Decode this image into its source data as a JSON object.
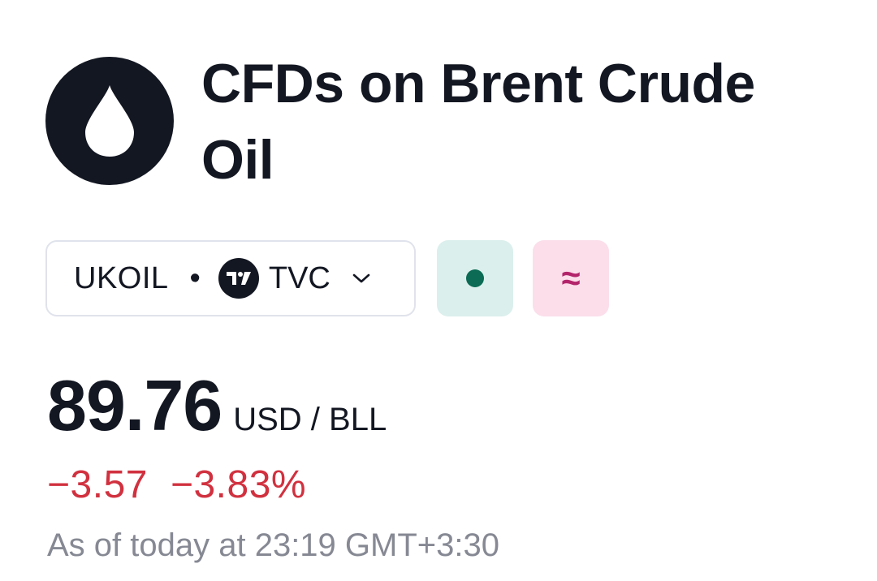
{
  "header": {
    "title": "CFDs on Brent Crude Oil",
    "logo_icon": "oil-drop-icon"
  },
  "symbol": {
    "ticker": "UKOIL",
    "separator": "•",
    "exchange_badge_icon": "tradingview-icon",
    "exchange_badge_text": "TV",
    "exchange": "TVC",
    "dropdown_icon": "chevron-down-icon"
  },
  "status": {
    "market_icon": "market-open-dot-icon",
    "delay_icon": "approximately-icon",
    "delay_glyph": "≈",
    "colors": {
      "market_bg": "#dbefec",
      "market_dot": "#0b6b54",
      "delay_bg": "#fbdeea",
      "delay_fg": "#b3246b"
    }
  },
  "quote": {
    "price": "89.76",
    "unit": "USD / BLL",
    "change": "−3.57",
    "change_percent": "−3.83%",
    "timestamp": "As of today at 23:19 GMT+3:30",
    "colors": {
      "negative": "#d1313f",
      "muted": "#868993"
    }
  }
}
